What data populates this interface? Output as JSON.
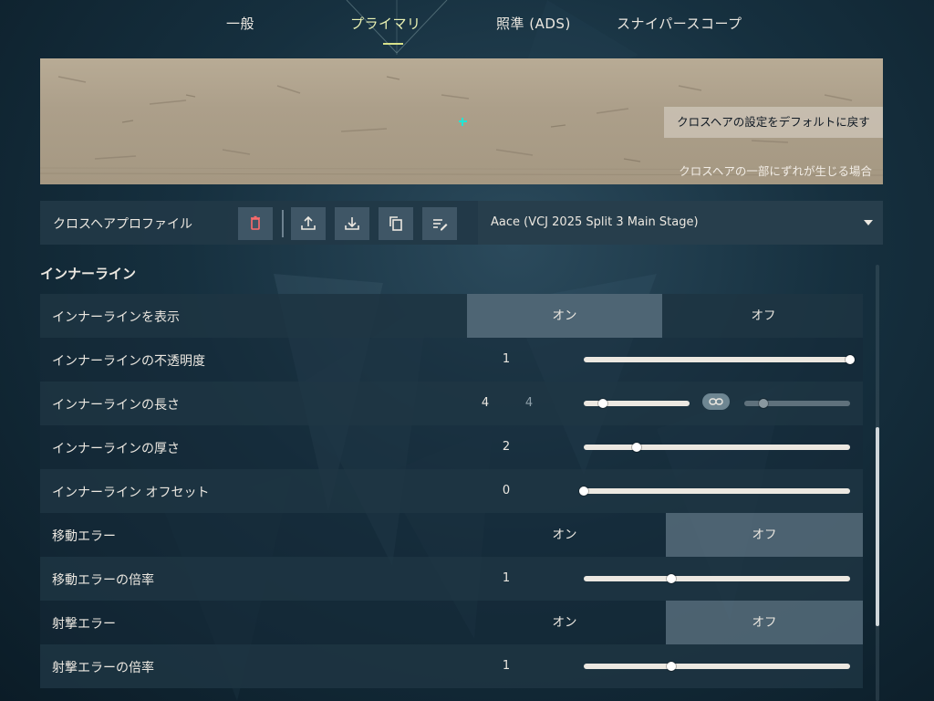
{
  "tabs": [
    {
      "label": "一般",
      "active": false
    },
    {
      "label": "プライマリ",
      "active": true
    },
    {
      "label": "照準 (ADS)",
      "active": false
    },
    {
      "label": "スナイパースコープ",
      "active": false
    }
  ],
  "preview": {
    "reset_label": "クロスヘアの設定をデフォルトに戻す",
    "misalign_label": "クロスヘアの一部にずれが生じる場合",
    "crosshair_color": "#1fe6d6"
  },
  "profile": {
    "label": "クロスヘアプロファイル",
    "buttons": [
      "trash-icon",
      "upload-icon",
      "download-icon",
      "copy-icon",
      "edit-list-icon"
    ],
    "selected": "Aace (VCJ 2025 Split 3 Main Stage)"
  },
  "section": {
    "title": "インナーライン",
    "rows": {
      "show": {
        "label": "インナーラインを表示",
        "on": "オン",
        "off": "オフ",
        "selected": "on"
      },
      "opacity": {
        "label": "インナーラインの不透明度",
        "value": "1",
        "fraction": 1.0
      },
      "length": {
        "label": "インナーラインの長さ",
        "value1": "4",
        "value2": "4",
        "fraction1": 0.18,
        "fraction2": 0.18
      },
      "thickness": {
        "label": "インナーラインの厚さ",
        "value": "2",
        "fraction": 0.2
      },
      "offset": {
        "label": "インナーライン オフセット",
        "value": "0",
        "fraction": 0.0
      },
      "move_error": {
        "label": "移動エラー",
        "on": "オン",
        "off": "オフ",
        "selected": "off"
      },
      "move_error_mult": {
        "label": "移動エラーの倍率",
        "value": "1",
        "fraction": 0.33
      },
      "fire_error": {
        "label": "射撃エラー",
        "on": "オン",
        "off": "オフ",
        "selected": "off"
      },
      "fire_error_mult": {
        "label": "射撃エラーの倍率",
        "value": "1",
        "fraction": 0.33
      }
    }
  },
  "colors": {
    "accent": "#d8e28a",
    "delete": "#ff6b6b"
  }
}
